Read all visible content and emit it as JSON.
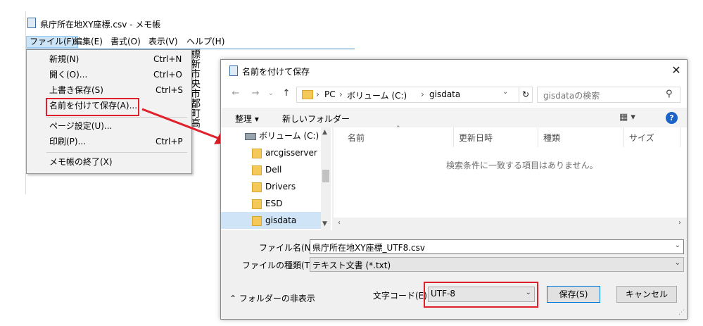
{
  "notepad": {
    "title": "県庁所在地XY座標.csv - メモ帳",
    "menus": [
      "ファイル(F)",
      "編集(E)",
      "書式(O)",
      "表示(V)",
      "ヘルプ(H)"
    ],
    "text_column": [
      "標",
      "新",
      "市",
      "央",
      "市",
      "都",
      "町",
      "高"
    ]
  },
  "file_menu": {
    "items": [
      {
        "label": "新規(N)",
        "shortcut": "Ctrl+N"
      },
      {
        "label": "開く(O)...",
        "shortcut": "Ctrl+O"
      },
      {
        "label": "上書き保存(S)",
        "shortcut": "Ctrl+S"
      },
      {
        "label": "名前を付けて保存(A)...",
        "shortcut": ""
      },
      {
        "label": "ページ設定(U)...",
        "shortcut": ""
      },
      {
        "label": "印刷(P)...",
        "shortcut": "Ctrl+P"
      },
      {
        "label": "メモ帳の終了(X)",
        "shortcut": ""
      }
    ]
  },
  "dialog": {
    "title": "名前を付けて保存",
    "close": "✕",
    "nav": {
      "back": "←",
      "forward": "→",
      "recent": "⌄",
      "up": "↑"
    },
    "address": {
      "crumbs": [
        "PC",
        "ボリューム (C:)",
        "gisdata"
      ],
      "separator": "›"
    },
    "refresh": "↻",
    "search_placeholder": "gisdataの検索",
    "toolbar": {
      "organize": "整理 ▾",
      "new_folder": "新しいフォルダー",
      "view": "▦ ▾",
      "help": "?"
    },
    "tree": [
      {
        "label": "ボリューム (C:)",
        "selected": false
      },
      {
        "label": "arcgisserver",
        "selected": false
      },
      {
        "label": "Dell",
        "selected": false
      },
      {
        "label": "Drivers",
        "selected": false
      },
      {
        "label": "ESD",
        "selected": false
      },
      {
        "label": "gisdata",
        "selected": true
      }
    ],
    "columns": [
      "名前",
      "更新日時",
      "種類",
      "サイズ"
    ],
    "empty_message": "検索条件に一致する項目はありません。",
    "filename_label": "ファイル名(N):",
    "filename_value": "県庁所在地XY座標_UTF8.csv",
    "filetype_label": "ファイルの種類(T):",
    "filetype_value": "テキスト文書 (*.txt)",
    "hide_folders": "フォルダーの非表示",
    "encoding_label": "文字コード(E)",
    "encoding_value": "UTF-8",
    "save_button": "保存(S)",
    "cancel_button": "キャンセル"
  },
  "colors": {
    "highlight_red": "#e0202a",
    "accent_blue": "#0078d7"
  }
}
